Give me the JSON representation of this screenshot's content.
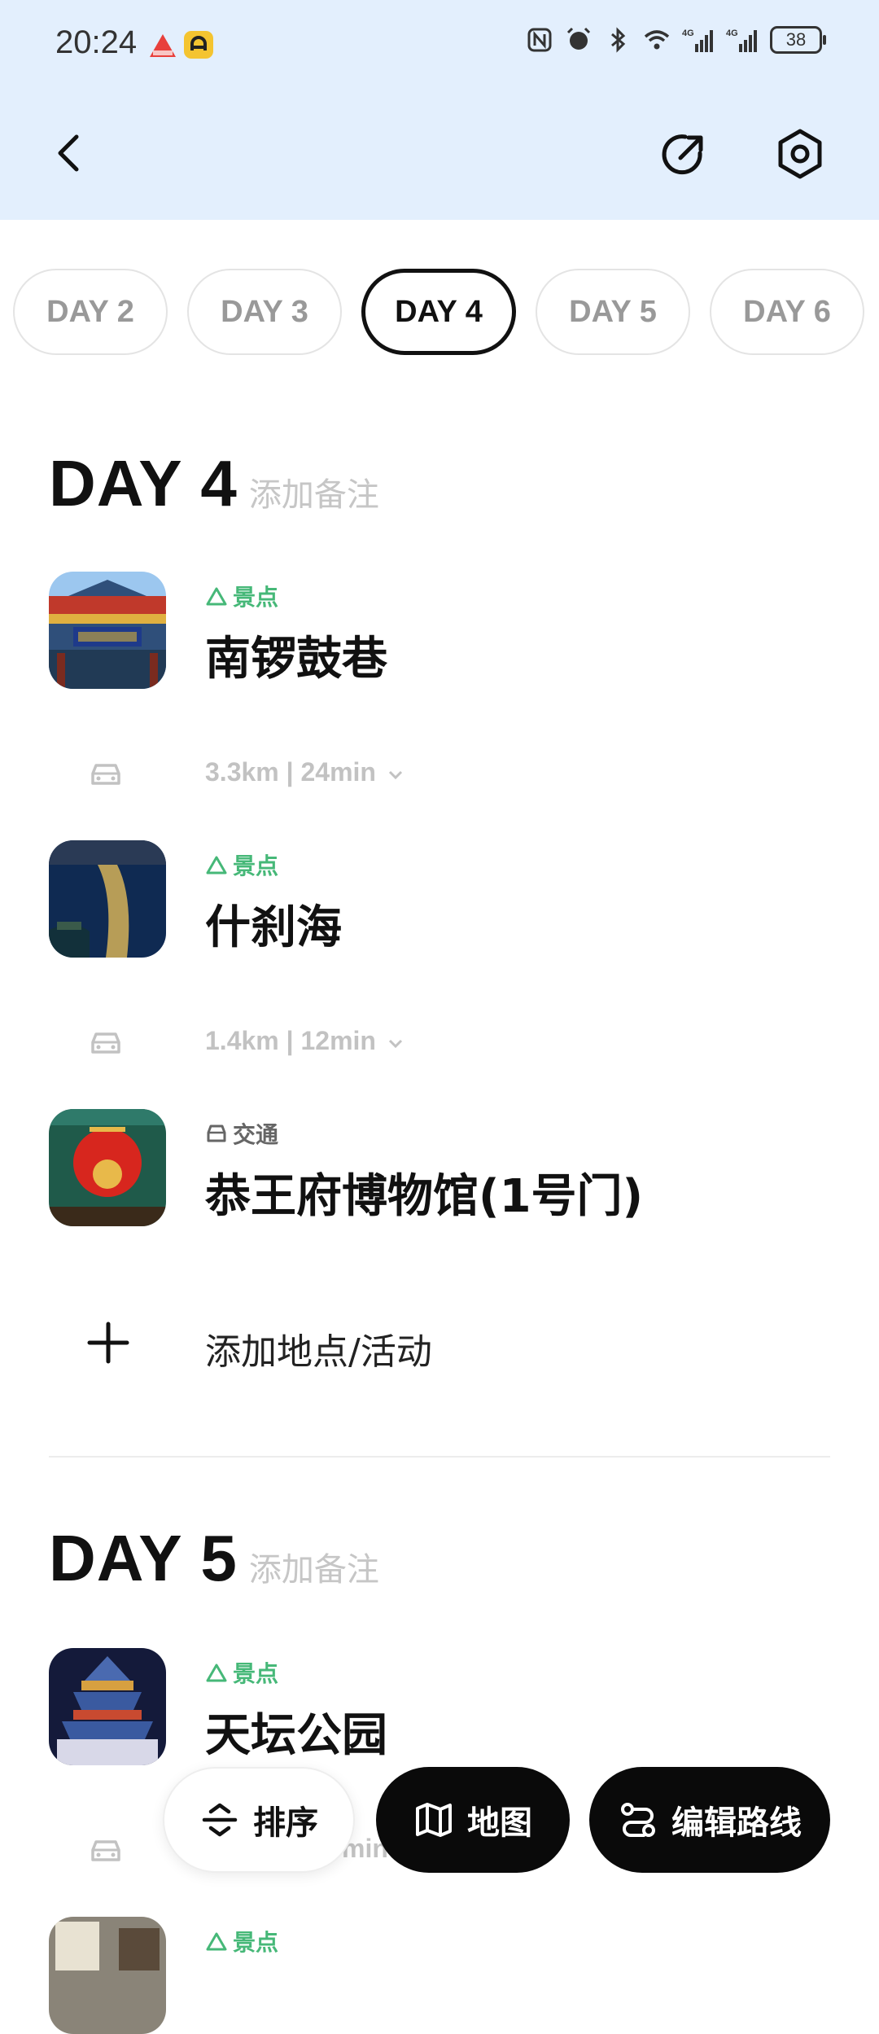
{
  "status_bar": {
    "time": "20:24",
    "battery": "38",
    "icons": [
      "nfc-icon",
      "alarm-icon",
      "bluetooth-icon",
      "wifi-icon",
      "signal-4g-icon",
      "signal-4g-icon",
      "battery-icon"
    ]
  },
  "header": {
    "back_icon": "chevron-left-icon",
    "share_icon": "share-icon",
    "settings_icon": "settings-icon"
  },
  "day_tabs": [
    "DAY 2",
    "DAY 3",
    "DAY 4",
    "DAY 5",
    "DAY 6"
  ],
  "active_tab": "DAY 4",
  "days": [
    {
      "title": "DAY 4",
      "note_placeholder": "添加备注",
      "places": [
        {
          "category": "景点",
          "name": "南锣鼓巷"
        },
        {
          "category": "景点",
          "name": "什刹海"
        },
        {
          "category": "交通",
          "name": "恭王府博物馆(1号门)"
        }
      ],
      "legs": [
        "3.3km | 24min",
        "1.4km | 12min"
      ],
      "add_label": "添加地点/活动"
    },
    {
      "title": "DAY 5",
      "note_placeholder": "添加备注",
      "places": [
        {
          "category": "景点",
          "name": "天坛公园"
        },
        {
          "category": "景点",
          "name": ""
        }
      ],
      "legs": [
        "min"
      ]
    }
  ],
  "actions": {
    "sort": "排序",
    "map": "地图",
    "edit_route": "编辑路线"
  },
  "colors": {
    "header_bg": "#e3effd",
    "scenic_green": "#46b878",
    "fab_dark": "#0a0a0a"
  }
}
